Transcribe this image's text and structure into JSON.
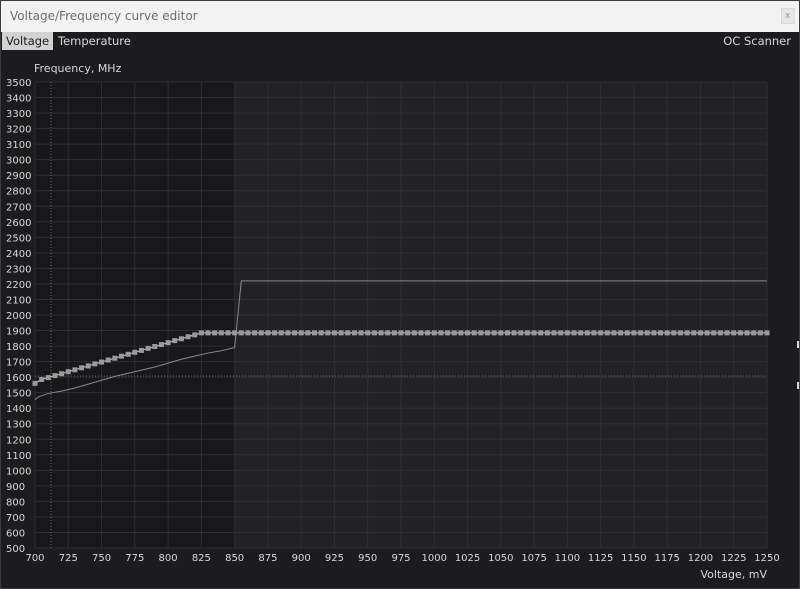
{
  "window": {
    "title": "Voltage/Frequency curve editor",
    "close_icon": "close-icon",
    "close_glyph": "x"
  },
  "tabs": [
    {
      "label": "Voltage",
      "active": true
    },
    {
      "label": "Temperature",
      "active": false
    }
  ],
  "oc_scanner_label": "OC Scanner",
  "colors": {
    "background": "#1c1c1e",
    "plot_locked_region": "#18181a",
    "plot_region": "#222226",
    "grid": "#2e2e34",
    "curve": "#bdbdbd",
    "points": "#9a9a9a",
    "reference_line": "#8a8a8a",
    "marker_line": "#6a6a6a",
    "text": "#d8d8d8"
  },
  "chart_data": {
    "type": "line",
    "xlabel": "Voltage, mV",
    "ylabel": "Frequency, MHz",
    "xlim": [
      700,
      1250
    ],
    "ylim": [
      500,
      3500
    ],
    "x_ticks": [
      700,
      725,
      750,
      775,
      800,
      825,
      850,
      875,
      900,
      925,
      950,
      975,
      1000,
      1025,
      1050,
      1075,
      1100,
      1125,
      1150,
      1175,
      1200,
      1225,
      1250
    ],
    "y_ticks": [
      500,
      600,
      700,
      800,
      900,
      1000,
      1100,
      1200,
      1300,
      1400,
      1500,
      1600,
      1700,
      1800,
      1900,
      2000,
      2100,
      2200,
      2300,
      2400,
      2500,
      2600,
      2700,
      2800,
      2900,
      3000,
      3100,
      3200,
      3300,
      3400,
      3500
    ],
    "grid": true,
    "locked_region_end_voltage": 850,
    "marker_voltage": 712,
    "marker_frequency": 1607,
    "series": [
      {
        "role": "reference",
        "x": [
          700,
          703,
          710,
          720,
          730,
          740,
          750,
          760,
          770,
          780,
          790,
          800,
          810,
          820,
          830,
          840,
          850,
          855,
          1250
        ],
        "y": [
          1455,
          1475,
          1495,
          1510,
          1530,
          1555,
          1580,
          1605,
          1625,
          1645,
          1665,
          1690,
          1715,
          1735,
          1755,
          1770,
          1790,
          2220,
          2220
        ]
      },
      {
        "role": "curve",
        "x": [
          700,
          705,
          710,
          715,
          720,
          725,
          730,
          735,
          740,
          745,
          750,
          755,
          760,
          765,
          770,
          775,
          780,
          785,
          790,
          795,
          800,
          805,
          810,
          815,
          820,
          825,
          830,
          835,
          840,
          845,
          850,
          855,
          860,
          865,
          870,
          875,
          880,
          885,
          890,
          895,
          900,
          905,
          910,
          915,
          920,
          925,
          930,
          935,
          940,
          945,
          950,
          955,
          960,
          965,
          970,
          975,
          980,
          985,
          990,
          995,
          1000,
          1005,
          1010,
          1015,
          1020,
          1025,
          1030,
          1035,
          1040,
          1045,
          1050,
          1055,
          1060,
          1065,
          1070,
          1075,
          1080,
          1085,
          1090,
          1095,
          1100,
          1105,
          1110,
          1115,
          1120,
          1125,
          1130,
          1135,
          1140,
          1145,
          1150,
          1155,
          1160,
          1165,
          1170,
          1175,
          1180,
          1185,
          1190,
          1195,
          1200,
          1205,
          1210,
          1215,
          1220,
          1225,
          1230,
          1235,
          1240,
          1245,
          1250
        ],
        "y": [
          1560,
          1585,
          1597,
          1610,
          1622,
          1635,
          1647,
          1660,
          1672,
          1685,
          1697,
          1710,
          1722,
          1735,
          1747,
          1760,
          1772,
          1785,
          1797,
          1810,
          1822,
          1835,
          1847,
          1860,
          1872,
          1885,
          1885,
          1885,
          1885,
          1885,
          1885,
          1885,
          1885,
          1885,
          1885,
          1885,
          1885,
          1885,
          1885,
          1885,
          1885,
          1885,
          1885,
          1885,
          1885,
          1885,
          1885,
          1885,
          1885,
          1885,
          1885,
          1885,
          1885,
          1885,
          1885,
          1885,
          1885,
          1885,
          1885,
          1885,
          1885,
          1885,
          1885,
          1885,
          1885,
          1885,
          1885,
          1885,
          1885,
          1885,
          1885,
          1885,
          1885,
          1885,
          1885,
          1885,
          1885,
          1885,
          1885,
          1885,
          1885,
          1885,
          1885,
          1885,
          1885,
          1885,
          1885,
          1885,
          1885,
          1885,
          1885,
          1885,
          1885,
          1885,
          1885,
          1885,
          1885,
          1885,
          1885,
          1885,
          1885,
          1885,
          1885,
          1885,
          1885,
          1885,
          1885,
          1885,
          1885,
          1885,
          1885
        ]
      }
    ]
  }
}
